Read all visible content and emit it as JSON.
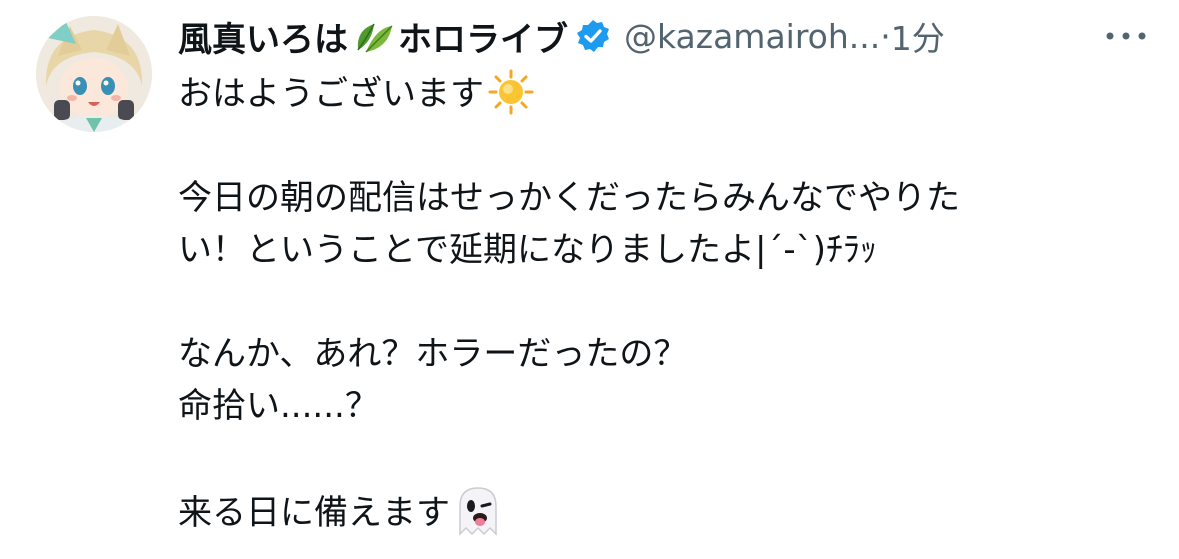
{
  "tweet": {
    "display_name": "風真いろは",
    "leaf_icon": "leaf-emoji",
    "brand_name": "ホロライブ",
    "verified_icon": "verified-badge-icon",
    "handle": "@kazamairoh...",
    "separator": " · ",
    "time": "1分",
    "more_icon": "more-options-icon",
    "lines": [
      "おはようございます",
      "",
      "今日の朝の配信はせっかくだったらみんなでやりた",
      "い！ということで延期になりましたよ|´-`)ﾁﾗｯ",
      "",
      "なんか、あれ？ホラーだったの？",
      "命拾い......？",
      "",
      "来る日に備えます"
    ],
    "emojis": {
      "line0": "sun-emoji",
      "line8": "ghost-emoji"
    }
  },
  "colors": {
    "text": "#0f1419",
    "secondary": "#536471",
    "verified": "#1d9bf0"
  }
}
